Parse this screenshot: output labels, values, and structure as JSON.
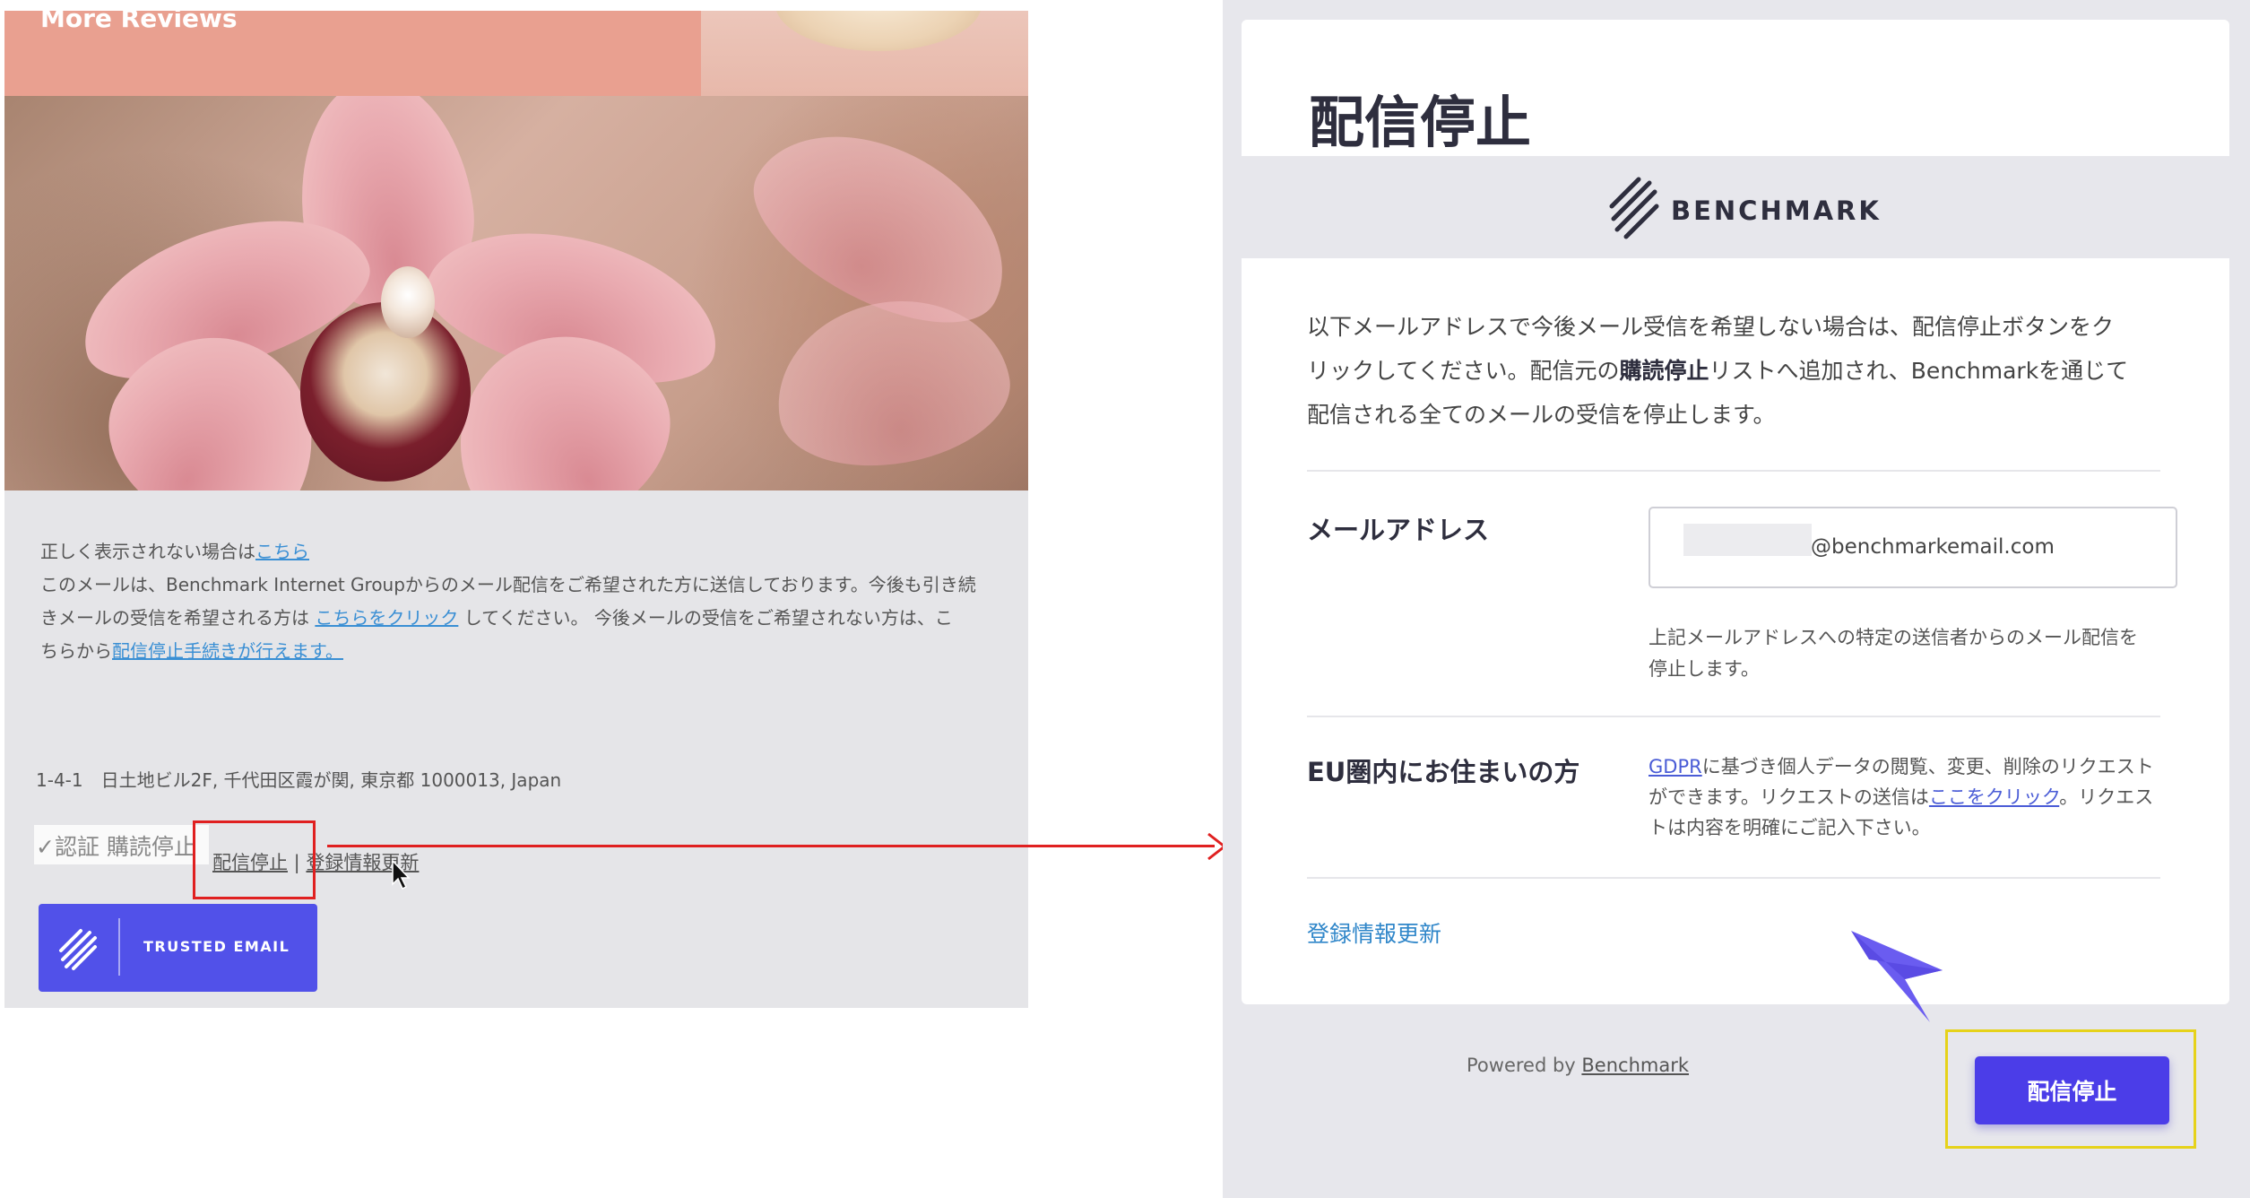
{
  "email_preview": {
    "header_text": "More Reviews",
    "line1_prefix": "正しく表示されない場合は",
    "line1_link": "こちら",
    "line2": "このメールは、Benchmark Internet Groupからのメール配信をご希望された方に送信しております。今後も引き続",
    "line3_prefix": "きメールの受信を希望される方は ",
    "line3_link": "こちらをクリック",
    "line3_suffix": " してください。 今後メールの受信をご希望されない方は、こ",
    "line4_prefix": "ちらから",
    "line4_link": "配信停止手続きが行えます。",
    "address": "1-4-1　日土地ビル2F, 千代田区霞が関, 東京都 1000013, Japan",
    "auth_text": "✓認証 購読停止",
    "unsubscribe_link": "配信停止",
    "separator": " | ",
    "update_link": "登録情報更新",
    "trusted_badge": "TRUSTED EMAIL"
  },
  "unsubscribe_page": {
    "title": "配信停止",
    "brand": "BENCHMARK",
    "intro_line1": "以下メールアドレスで今後メール受信を希望しない場合は、配信停止ボタンをク",
    "intro_line2_prefix": "リックしてください。配信元の",
    "intro_line2_bold": "購読停止",
    "intro_line2_suffix": "リストへ追加され、Benchmarkを通じて",
    "intro_line3": "配信される全てのメールの受信を停止します。",
    "email_label": "メールアドレス",
    "email_value": "@benchmarkemail.com",
    "email_help": "上記メールアドレスへの特定の送信者からのメール配信を停止します。",
    "eu_label": "EU圏内にお住まいの方",
    "eu_link1": "GDPR",
    "eu_text1": "に基づき個人データの閲覧、変更、削除のリクエストができます。リクエストの送信は",
    "eu_link2": "ここをクリック",
    "eu_text2": "。リクエストは内容を明確にご記入下さい。",
    "update_link": "登録情報更新",
    "powered_prefix": "Powered by ",
    "powered_link": "Benchmark",
    "unsubscribe_button": "配信停止"
  },
  "colors": {
    "button": "#4b3de8",
    "highlight_red": "#e02020",
    "highlight_yellow": "#e6d21a",
    "arrow_purple": "#6a5cf0"
  }
}
